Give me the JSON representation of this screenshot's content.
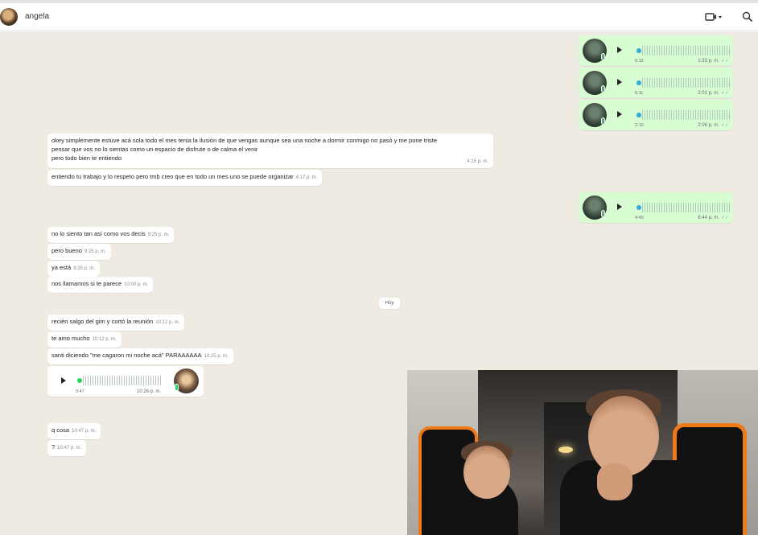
{
  "header": {
    "contact_name": "angela",
    "icons": [
      "video-call-icon",
      "chevron-down-icon",
      "search-icon"
    ]
  },
  "outgoing_voice": [
    {
      "duration": "0:15",
      "time": "1:33 p. m."
    },
    {
      "duration": "5:11",
      "time": "2:01 p. m."
    },
    {
      "duration": "2:10",
      "time": "2:06 p. m."
    },
    {
      "duration": "4:40",
      "time": "8:44 p. m."
    }
  ],
  "messages": {
    "m1": {
      "line1": "okey simplemente estuve acá sola todo el mes tenia la ilusión de que vengas aunque sea una noche a dormir conmigo no pasó y me pone triste",
      "line2": "pensar que vos no lo sientas como un espacio de disfrute o de calma el venir",
      "line3": "pero todo bien te entiendo",
      "time": "4:15 p. m."
    },
    "m2": {
      "text": "entiendo tu trabajo y lo respeto pero tmb creo que en todo un mes uno se puede organizar",
      "time": "4:17 p. m."
    },
    "m3": {
      "text": "no lo siento tan así como vos decis",
      "time": "9:25 p. m."
    },
    "m4": {
      "text": "pero bueno",
      "time": "9:25 p. m."
    },
    "m5": {
      "text": "ya está",
      "time": "9:25 p. m."
    },
    "m6": {
      "text": "nos llamamos si te parece",
      "time": "10:00 p. m."
    },
    "m7": {
      "text": "recién salgo del gim y cortó la reunión",
      "time": "10:12 p. m."
    },
    "m8": {
      "text": "te amo mucho",
      "time": "10:12 p. m."
    },
    "m9": {
      "text": "santi diciendo \"me cagaron mi noche acá\" PARAAAAAA",
      "time": "10:25 p. m."
    },
    "m10": {
      "text": "q cosa",
      "time": "10:47 p. m."
    },
    "m11": {
      "text": "?",
      "time": "10:47 p. m."
    }
  },
  "day_divider": "Hoy",
  "incoming_voice": {
    "duration": "0:47",
    "time": "10:26 p. m."
  },
  "colors": {
    "outgoing": "#d9fdd3",
    "incoming": "#ffffff",
    "background": "#efeae2",
    "accent_green": "#25d366",
    "chair_orange": "#f07a17"
  }
}
